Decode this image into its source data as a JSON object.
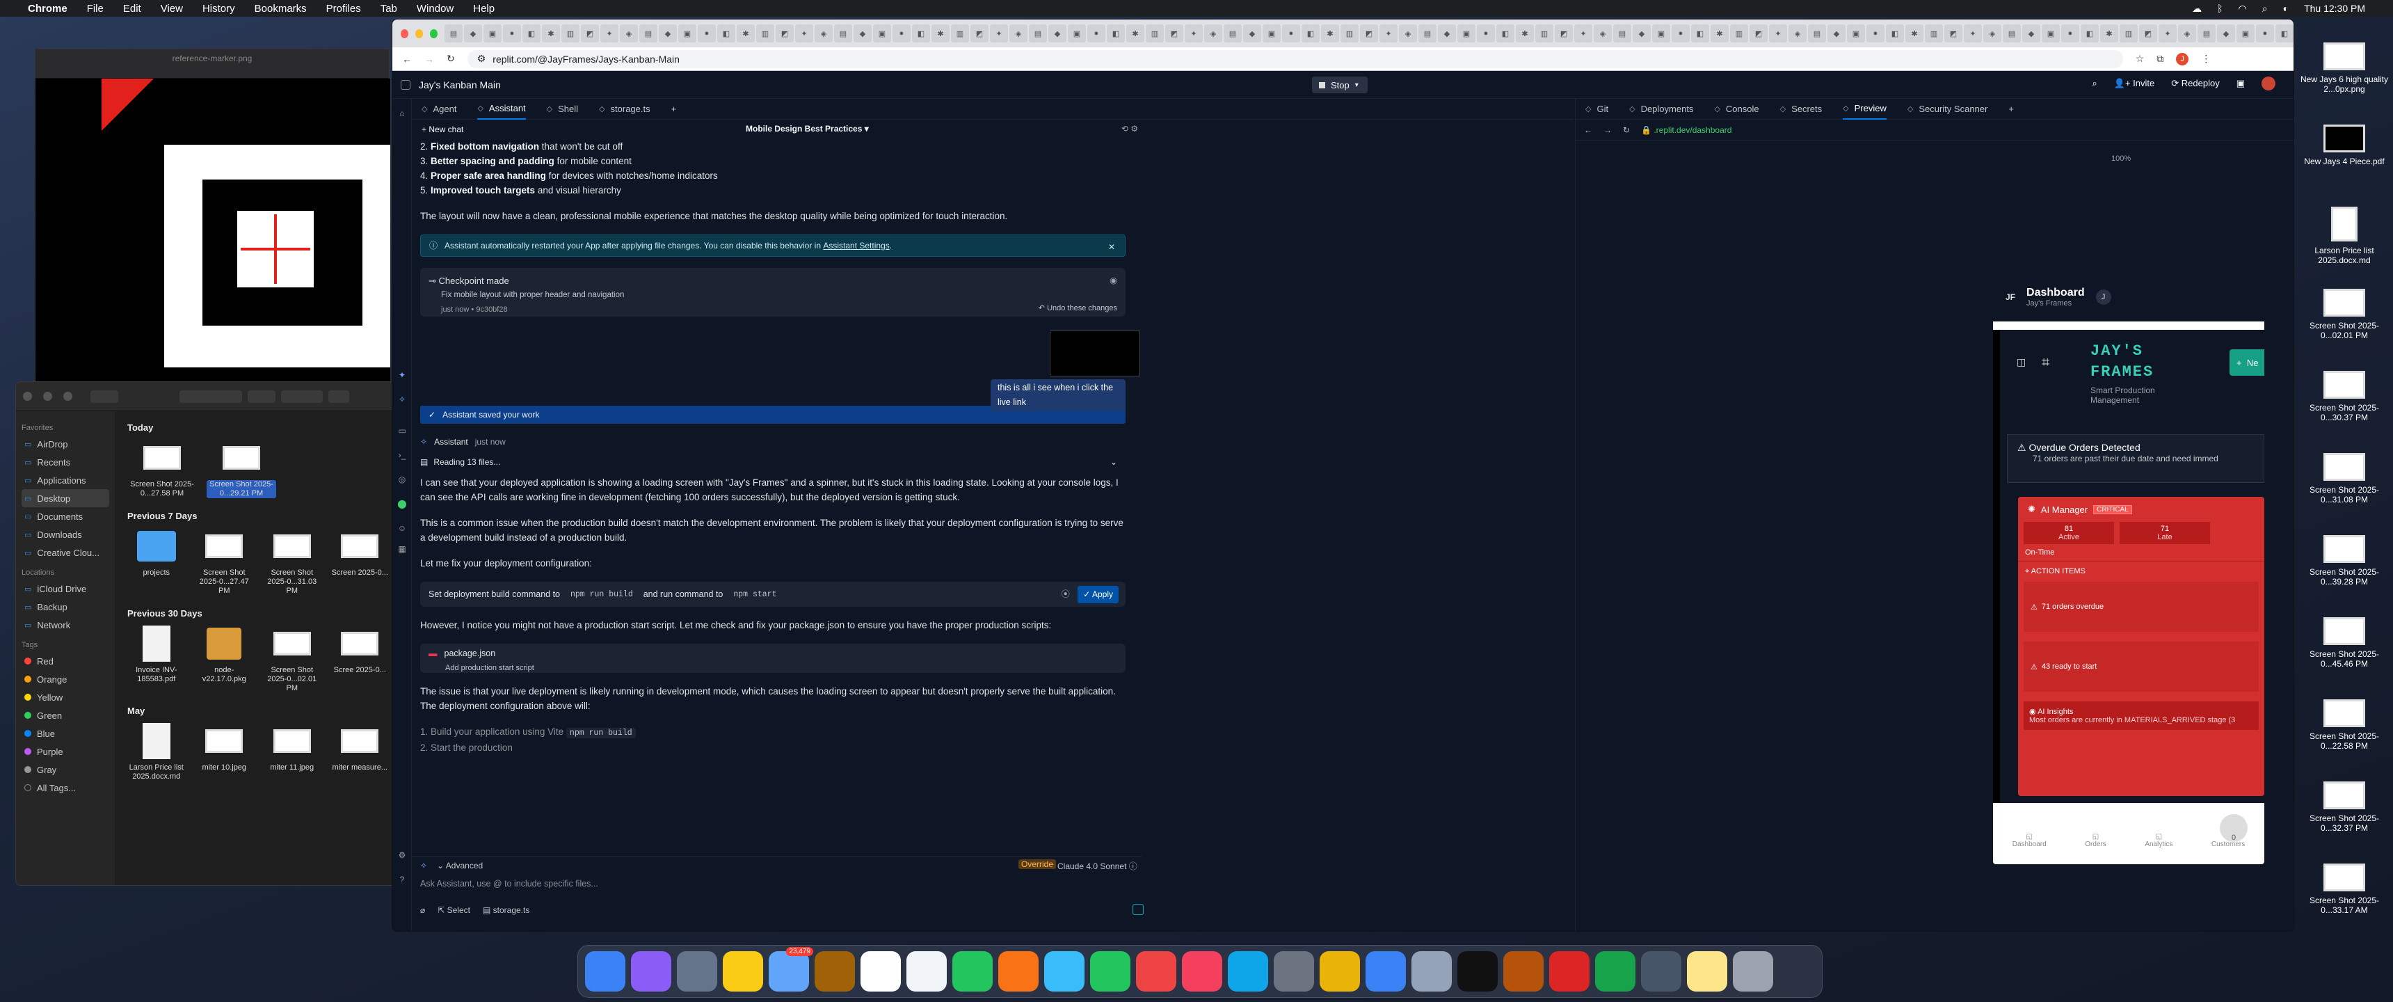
{
  "menubar": {
    "app": "Chrome",
    "items": [
      "File",
      "Edit",
      "View",
      "History",
      "Bookmarks",
      "Profiles",
      "Tab",
      "Window",
      "Help"
    ],
    "clock": "Thu 12:30 PM"
  },
  "preview_app": {
    "title": "reference-marker.png"
  },
  "finder": {
    "sidebar": {
      "favorites_label": "Favorites",
      "favorites": [
        "AirDrop",
        "Recents",
        "Applications",
        "Desktop",
        "Documents",
        "Downloads",
        "Creative Clou..."
      ],
      "locations_label": "Locations",
      "locations": [
        "iCloud Drive",
        "Backup",
        "Network"
      ],
      "tags_label": "Tags",
      "tags": [
        {
          "name": "Red",
          "color": "#ff453a"
        },
        {
          "name": "Orange",
          "color": "#ff9f0a"
        },
        {
          "name": "Yellow",
          "color": "#ffd60a"
        },
        {
          "name": "Green",
          "color": "#30d158"
        },
        {
          "name": "Blue",
          "color": "#0a84ff"
        },
        {
          "name": "Purple",
          "color": "#bf5af2"
        },
        {
          "name": "Gray",
          "color": "#98989d"
        },
        {
          "name": "All Tags..."
        }
      ]
    },
    "sections": [
      {
        "title": "Today",
        "files": [
          {
            "name": "Screen Shot 2025-0...27.58 PM",
            "kind": "shot"
          },
          {
            "name": "Screen Shot 2025-0...29.21 PM",
            "kind": "shot",
            "selected": true
          }
        ]
      },
      {
        "title": "Previous 7 Days",
        "files": [
          {
            "name": "projects",
            "kind": "folder"
          },
          {
            "name": "Screen Shot 2025-0...27.47 PM",
            "kind": "shot"
          },
          {
            "name": "Screen Shot 2025-0...31.03 PM",
            "kind": "shot"
          },
          {
            "name": "Screen 2025-0...",
            "kind": "shot"
          }
        ]
      },
      {
        "title": "Previous 30 Days",
        "files": [
          {
            "name": "Invoice INV-185583.pdf",
            "kind": "pdf"
          },
          {
            "name": "node-v22.17.0.pkg",
            "kind": "pkg"
          },
          {
            "name": "Screen Shot 2025-0...02.01 PM",
            "kind": "shot"
          },
          {
            "name": "Scree 2025-0...",
            "kind": "shot"
          }
        ]
      },
      {
        "title": "May",
        "files": [
          {
            "name": "Larson Price list 2025.docx.md",
            "kind": "doc"
          },
          {
            "name": "miter 10.jpeg",
            "kind": "img"
          },
          {
            "name": "miter 11.jpeg",
            "kind": "img"
          },
          {
            "name": "miter measure...",
            "kind": "img"
          }
        ]
      }
    ]
  },
  "chrome": {
    "url": "replit.com/@JayFrames/Jays-Kanban-Main"
  },
  "replit": {
    "project_name": "Jay's Kanban Main",
    "stop_label": "Stop",
    "invite_label": "Invite",
    "redeploy_label": "Redeploy",
    "avatar_letter": "J",
    "left_tabs": [
      "Agent",
      "Assistant",
      "Shell",
      "storage.ts"
    ],
    "right_tabs": [
      "Git",
      "Deployments",
      "Console",
      "Secrets",
      "Preview",
      "Security Scanner"
    ],
    "new_chat": "New chat",
    "chat_title": "Mobile Design Best Practices",
    "list1": [
      {
        "n": "2.",
        "b": "Fixed bottom navigation",
        "t": " that won't be cut off"
      },
      {
        "n": "3.",
        "b": "Better spacing and padding",
        "t": " for mobile content"
      },
      {
        "n": "4.",
        "b": "Proper safe area handling",
        "t": " for devices with notches/home indicators"
      },
      {
        "n": "5.",
        "b": "Improved touch targets",
        "t": " and visual hierarchy"
      }
    ],
    "p_layout": "The layout will now have a clean, professional mobile experience that matches the desktop quality while being optimized for touch interaction.",
    "restart_note": "Assistant automatically restarted your App after applying file changes. You can disable this behavior in",
    "restart_link": "Assistant Settings",
    "checkpoint": {
      "title": "Checkpoint made",
      "desc": "Fix mobile layout with proper header and navigation",
      "meta": "just now",
      "hash": "• 9c30bf28",
      "undo": "Undo these changes"
    },
    "user_msg": "this is all i see when i click the live link",
    "saved": "Assistant saved your work",
    "assistant_name": "Assistant",
    "assistant_time": "just now",
    "reading": "Reading 13 files...",
    "p1": "I can see that your deployed application is showing a loading screen with \"Jay's Frames\" and a spinner, but it's stuck in this loading state. Looking at your console logs, I can see the API calls are working fine in development (fetching 100 orders successfully), but the deployed version is getting stuck.",
    "p2": "This is a common issue when the production build doesn't match the development environment. The problem is likely that your deployment configuration is trying to serve a development build instead of a production build.",
    "p3": "Let me fix your deployment configuration:",
    "deploy_card": {
      "a": "Set deployment build command to",
      "c1": "npm run build",
      "b": "and run command to",
      "c2": "npm start",
      "apply": "Apply"
    },
    "p4": "However, I notice you might not have a production start script. Let me check and fix your package.json to ensure you have the proper production scripts:",
    "pkg_card": {
      "file": "package.json",
      "desc": "Add production start script"
    },
    "p5": "The issue is that your live deployment is likely running in development mode, which causes the loading screen to appear but doesn't properly serve the built application. The deployment configuration above will:",
    "list2": [
      {
        "n": "1.",
        "t": "Build your application using Vite",
        "c": "npm run build"
      },
      {
        "n": "2.",
        "t": "Start the production"
      }
    ],
    "advanced": "Advanced",
    "override": "Override",
    "model": "Claude 4.0 Sonnet",
    "input_placeholder": "Ask Assistant, use @ to include specific files...",
    "select_label": "Select",
    "file_chip": "storage.ts",
    "preview_url": ".replit.dev/dashboard",
    "zoom": "100%"
  },
  "app_preview": {
    "initials": "JF",
    "title": "Dashboard",
    "subtitle": "Jay's Frames",
    "user": "J",
    "brand": "JAY'S FRAMES",
    "tagline": "Smart Production Management",
    "new_btn": "Ne",
    "alert_title": "Overdue Orders Detected",
    "alert_text": "71 orders are past their due date and need immed",
    "ai_manager": "AI Manager",
    "critical": "CRITICAL",
    "stats": [
      {
        "v": "81",
        "l": "Active"
      },
      {
        "v": "71",
        "l": "Late"
      }
    ],
    "ontime": "On-Time",
    "action_items": "ACTION ITEMS",
    "actions": [
      "71 orders overdue",
      "43 ready to start"
    ],
    "insights_title": "AI Insights",
    "insights_text": "Most orders are currently in MATERIALS_ARRIVED stage (3",
    "nav": [
      "Dashboard",
      "Orders",
      "Analytics",
      "Customers"
    ],
    "badge": "0"
  },
  "desktop_files": [
    {
      "name": "New Jays 6 high quality 2...0px.png"
    },
    {
      "name": "New Jays 4 Piece.pdf"
    },
    {
      "name": "Larson Price list 2025.docx.md"
    },
    {
      "name": "Screen Shot 2025-0...02.01 PM"
    },
    {
      "name": "Screen Shot 2025-0...30.37 PM"
    },
    {
      "name": "Screen Shot 2025-0...31.08 PM"
    },
    {
      "name": "Screen Shot 2025-0...39.28 PM"
    },
    {
      "name": "Screen Shot 2025-0...45.46 PM"
    },
    {
      "name": "Screen Shot 2025-0...22.58 PM"
    },
    {
      "name": "Screen Shot 2025-0...32.37 PM"
    },
    {
      "name": "Screen Shot 2025-0...33.17 AM"
    }
  ],
  "dock": {
    "apps": [
      "Finder",
      "Siri",
      "Launchpad",
      "Notes",
      "Mail",
      "Files",
      "Calendar",
      "Reminders",
      "Maps",
      "Photos",
      "Messages",
      "FaceTime",
      "News",
      "Music",
      "App Store",
      "System Settings",
      "Chrome",
      "Safari",
      "Preview",
      "Terminal",
      "Dictionary",
      "Creative Cloud",
      "Numbers",
      "Screenshot",
      "Stickies",
      "Trash"
    ],
    "mail_badge": "23,479"
  }
}
